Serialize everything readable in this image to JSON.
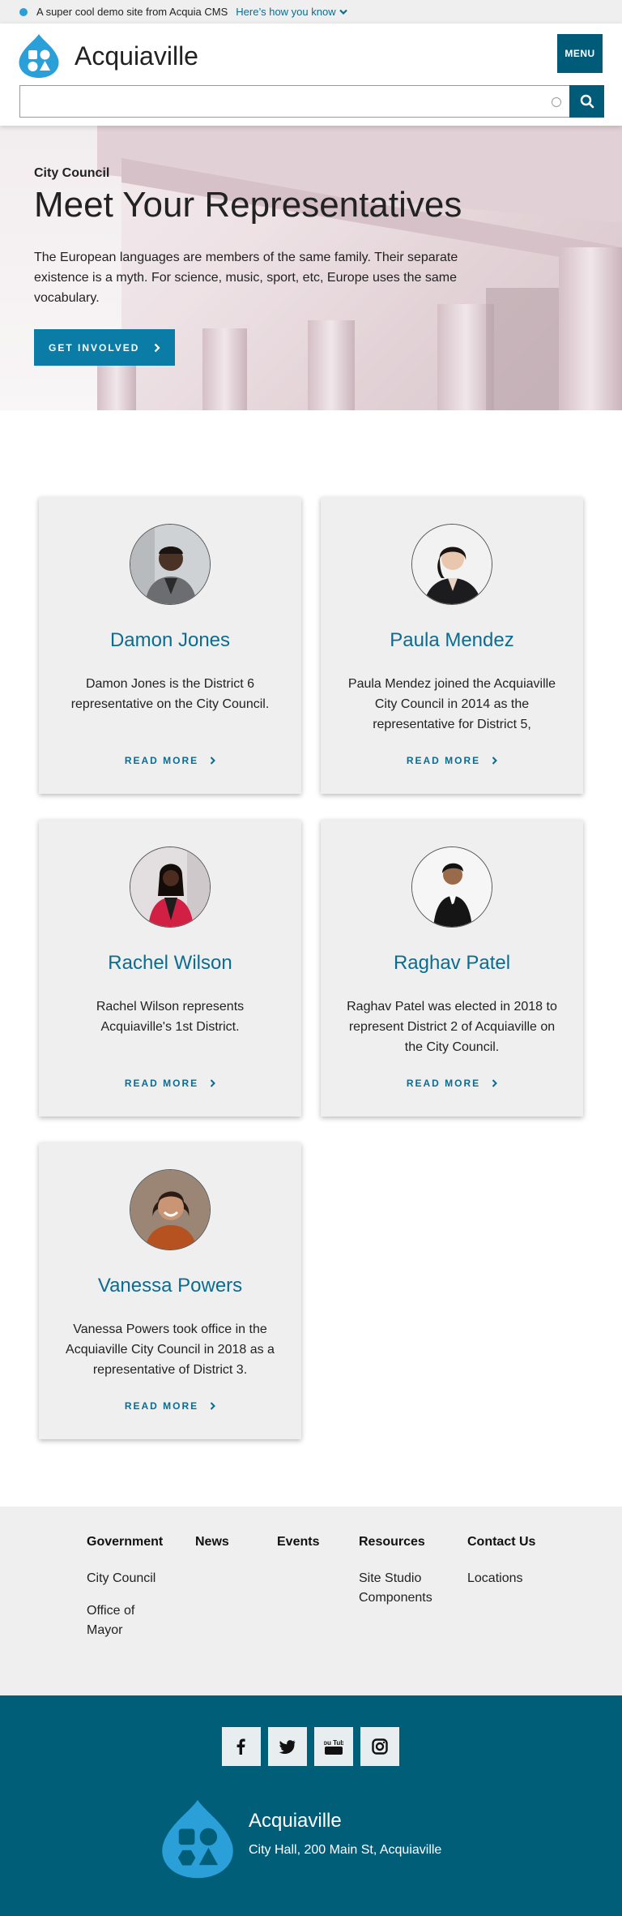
{
  "notice": {
    "message": "A super cool demo site from Acquia CMS",
    "link": "Here’s how you know"
  },
  "header": {
    "site_name": "Acquiaville",
    "menu_label": "MENU",
    "search_placeholder": ""
  },
  "hero": {
    "eyebrow": "City Council",
    "title": "Meet Your Representatives",
    "body": "The European languages are members of the same family. Their separate existence is a myth. For science, music, sport, etc, Europe uses the same vocabulary.",
    "cta_label": "GET INVOLVED"
  },
  "cards": [
    {
      "name": "Damon Jones",
      "bio": "Damon Jones is the District 6 representative on the City Council.",
      "link": "READ MORE"
    },
    {
      "name": "Paula Mendez",
      "bio": "Paula Mendez joined the Acquiaville City Council in 2014 as the representative for District 5,",
      "link": "READ MORE"
    },
    {
      "name": "Rachel Wilson",
      "bio": "Rachel Wilson represents Acquiaville's 1st District.",
      "link": "READ MORE"
    },
    {
      "name": "Raghav Patel",
      "bio": "Raghav Patel was elected in 2018 to represent District 2 of Acquiaville on the City Council.",
      "link": "READ MORE"
    },
    {
      "name": "Vanessa Powers",
      "bio": "Vanessa Powers took office in the Acquiaville City Council in 2018 as a representative of District 3.",
      "link": "READ MORE"
    }
  ],
  "footer_menu": {
    "columns": [
      {
        "heading": "Government",
        "items": [
          "City Council",
          "Office of Mayor"
        ]
      },
      {
        "heading": "News",
        "items": []
      },
      {
        "heading": "Events",
        "items": []
      },
      {
        "heading": "Resources",
        "items": [
          "Site Studio Components"
        ]
      },
      {
        "heading": "Contact Us",
        "items": [
          "Locations"
        ]
      }
    ]
  },
  "footer": {
    "social": [
      "facebook-icon",
      "twitter-icon",
      "youtube-icon",
      "instagram-icon"
    ],
    "youtube_text": "You Tube",
    "name": "Acquiaville",
    "address": "City Hall, 200 Main St, Acquiaville"
  },
  "colors": {
    "brand_dark": "#005b78",
    "brand_link": "#0b6c92",
    "brand_light": "#2a9fd8",
    "cta": "#0b7ca6"
  }
}
